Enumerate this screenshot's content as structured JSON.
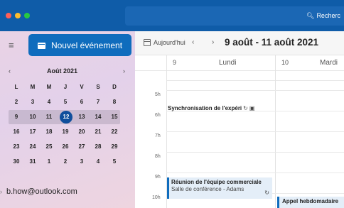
{
  "titlebar": {
    "window_controls": [
      {
        "name": "close",
        "color": "#ff5f57"
      },
      {
        "name": "minimize",
        "color": "#febc2e"
      },
      {
        "name": "zoom",
        "color": "#28c840"
      }
    ],
    "search_label": "Recherc"
  },
  "sidebar": {
    "new_event_label": "Nouvel événement",
    "mini_calendar": {
      "title": "Août 2021",
      "weekdays": [
        "L",
        "M",
        "M",
        "J",
        "V",
        "S",
        "D"
      ],
      "weeks": [
        [
          "2",
          "3",
          "4",
          "5",
          "6",
          "7",
          "8"
        ],
        [
          "9",
          "10",
          "11",
          "12",
          "13",
          "14",
          "15"
        ],
        [
          "16",
          "17",
          "18",
          "19",
          "20",
          "21",
          "22"
        ],
        [
          "23",
          "24",
          "25",
          "26",
          "27",
          "28",
          "29"
        ],
        [
          "30",
          "31",
          "1",
          "2",
          "3",
          "4",
          "5"
        ]
      ],
      "selected_day": "12"
    },
    "account": "b.how@outlook.com"
  },
  "toolbar": {
    "today_label": "Aujourd'hui",
    "date_range": "9 août - 11 août 2021"
  },
  "days": [
    {
      "num": "9",
      "name": "Lundi"
    },
    {
      "num": "10",
      "name": "Mardi"
    }
  ],
  "hours": [
    "5h",
    "6h",
    "7h",
    "8h",
    "9h",
    "10h"
  ],
  "events": {
    "sync": {
      "title": "Synchronisation de l'expéri"
    },
    "meeting": {
      "title": "Réunion de l'équipe commerciale",
      "location": "Salle de conférence - Adams"
    },
    "weekly": {
      "title": "Appel hebdomadaire"
    }
  },
  "colors": {
    "accent": "#0f6cbd",
    "titlebar": "#0f5ca8",
    "today": "#0f4e9c"
  }
}
